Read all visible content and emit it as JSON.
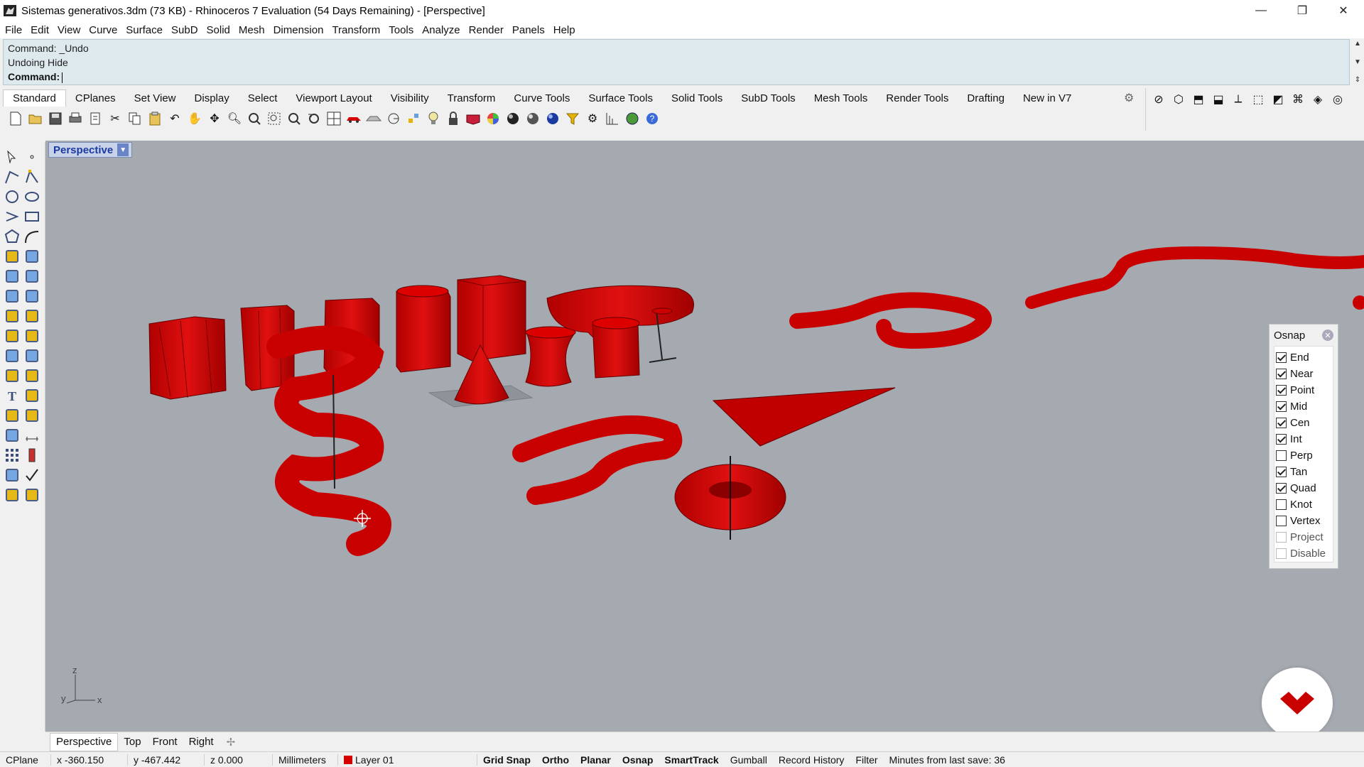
{
  "window": {
    "title": "Sistemas generativos.3dm (73 KB) - Rhinoceros 7 Evaluation (54 Days Remaining) - [Perspective]",
    "minimize_glyph": "—",
    "restore_glyph": "❐",
    "close_glyph": "✕"
  },
  "menu": [
    "File",
    "Edit",
    "View",
    "Curve",
    "Surface",
    "SubD",
    "Solid",
    "Mesh",
    "Dimension",
    "Transform",
    "Tools",
    "Analyze",
    "Render",
    "Panels",
    "Help"
  ],
  "command": {
    "history": [
      "Command: _Undo",
      "Undoing Hide"
    ],
    "prompt": "Command:"
  },
  "toolbar_tabs": [
    "Standard",
    "CPlanes",
    "Set View",
    "Display",
    "Select",
    "Viewport Layout",
    "Visibility",
    "Transform",
    "Curve Tools",
    "Surface Tools",
    "Solid Tools",
    "SubD Tools",
    "Mesh Tools",
    "Render Tools",
    "Drafting",
    "New in V7"
  ],
  "standard_icons": [
    "new-icon",
    "open-icon",
    "save-icon",
    "print-icon",
    "import-icon",
    "cut-icon",
    "copy-icon",
    "paste-icon",
    "undo-icon",
    "pan-icon",
    "rotate-icon",
    "zoom-icon",
    "zoom-window-icon",
    "zoom-extents-icon",
    "zoom-selected-icon",
    "undo-view-icon",
    "four-viewports-icon",
    "car-icon",
    "mesh-icon",
    "circle-tool-icon",
    "points-icon",
    "light-icon",
    "lock-icon",
    "material-icon",
    "color-wheel-icon",
    "sphere-icon",
    "shaded-sphere-icon",
    "render-sphere-icon",
    "filter-icon",
    "gear-cluster-icon",
    "grid-icon",
    "globe-icon",
    "help-icon"
  ],
  "viewport": {
    "active_label": "Perspective",
    "axis_labels": {
      "z": "z",
      "y": "y",
      "x": "x"
    }
  },
  "osnap": {
    "title": "Osnap",
    "items": [
      {
        "label": "End",
        "checked": true,
        "enabled": true
      },
      {
        "label": "Near",
        "checked": true,
        "enabled": true
      },
      {
        "label": "Point",
        "checked": true,
        "enabled": true
      },
      {
        "label": "Mid",
        "checked": true,
        "enabled": true
      },
      {
        "label": "Cen",
        "checked": true,
        "enabled": true
      },
      {
        "label": "Int",
        "checked": true,
        "enabled": true
      },
      {
        "label": "Perp",
        "checked": false,
        "enabled": true
      },
      {
        "label": "Tan",
        "checked": true,
        "enabled": true
      },
      {
        "label": "Quad",
        "checked": true,
        "enabled": true
      },
      {
        "label": "Knot",
        "checked": false,
        "enabled": true
      },
      {
        "label": "Vertex",
        "checked": false,
        "enabled": true
      },
      {
        "label": "Project",
        "checked": false,
        "enabled": false
      },
      {
        "label": "Disable",
        "checked": false,
        "enabled": false
      }
    ]
  },
  "view_tabs": [
    "Perspective",
    "Top",
    "Front",
    "Right"
  ],
  "view_tab_add": "✢",
  "status": {
    "cplane": "CPlane",
    "x": "x -360.150",
    "y": "y -467.442",
    "z": "z 0.000",
    "units": "Millimeters",
    "layer": "Layer 01",
    "layer_color": "#d40000",
    "toggles": [
      "Grid Snap",
      "Ortho",
      "Planar",
      "Osnap",
      "SmartTrack"
    ],
    "gumball": "Gumball",
    "record_history": "Record History",
    "filter": "Filter",
    "minutes": "Minutes from last save: 36"
  },
  "colors": {
    "object": "#d80000",
    "viewport_bg": "#a5a9b0",
    "active_tab": "#1a3aa0"
  }
}
